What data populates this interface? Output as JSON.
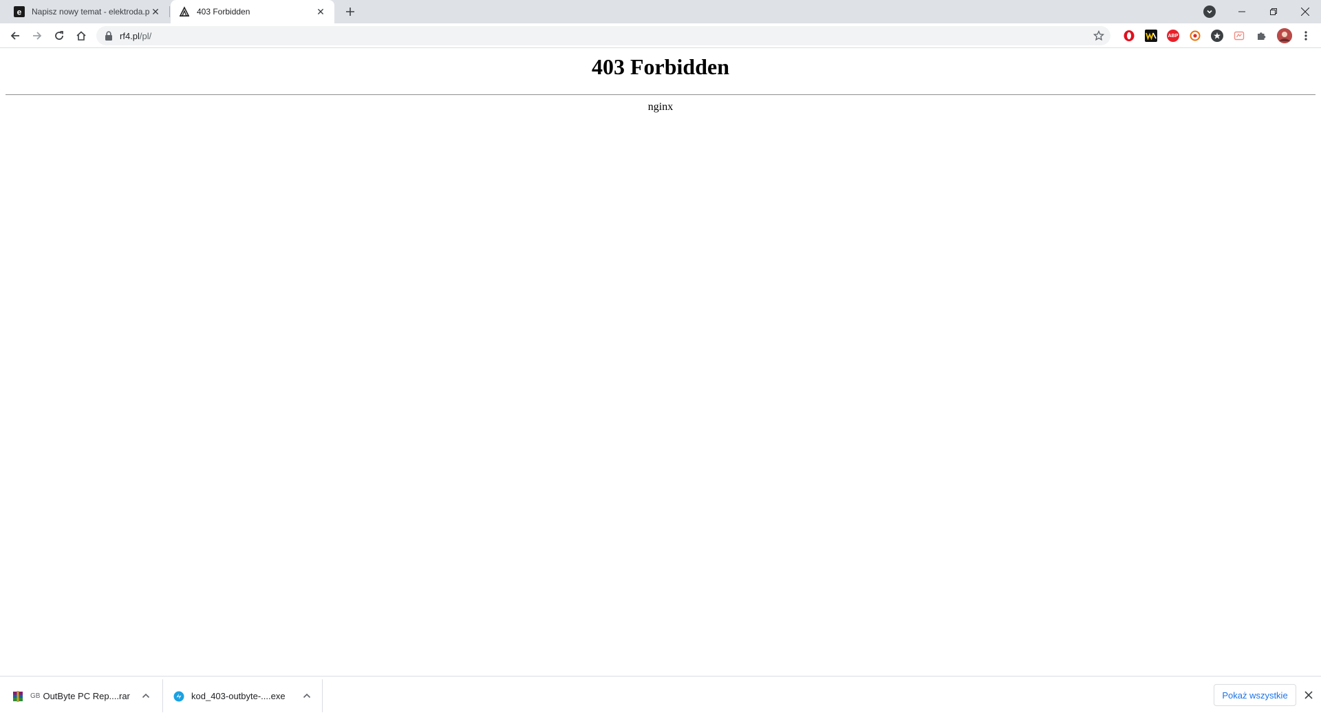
{
  "tabs": [
    {
      "title": "Napisz nowy temat - elektroda.pl",
      "active": false,
      "favicon": "elektroda-favicon-icon"
    },
    {
      "title": "403 Forbidden",
      "active": true,
      "favicon": "rf4-favicon-icon"
    }
  ],
  "omnibox": {
    "domain": "rf4.pl",
    "path": "/pl/"
  },
  "extensions": [
    "opera-icon",
    "wykop-icon",
    "adblock-plus-icon",
    "extension-icon-orange",
    "extension-icon-dark",
    "extension-icon-red-outline",
    "puzzle-icon",
    "profile-avatar"
  ],
  "page": {
    "heading": "403 Forbidden",
    "server": "nginx"
  },
  "downloads": {
    "items": [
      {
        "size_prefix": "GB",
        "name": "OutByte PC Rep....rar",
        "icon": "winrar-icon"
      },
      {
        "size_prefix": "",
        "name": "kod_403-outbyte-....exe",
        "icon": "outbyte-exe-icon"
      }
    ],
    "show_all_label": "Pokaż wszystkie"
  },
  "colors": {
    "tabstrip_bg": "#dee1e6",
    "omnibox_bg": "#f1f3f4",
    "link_blue": "#1a73e8"
  }
}
